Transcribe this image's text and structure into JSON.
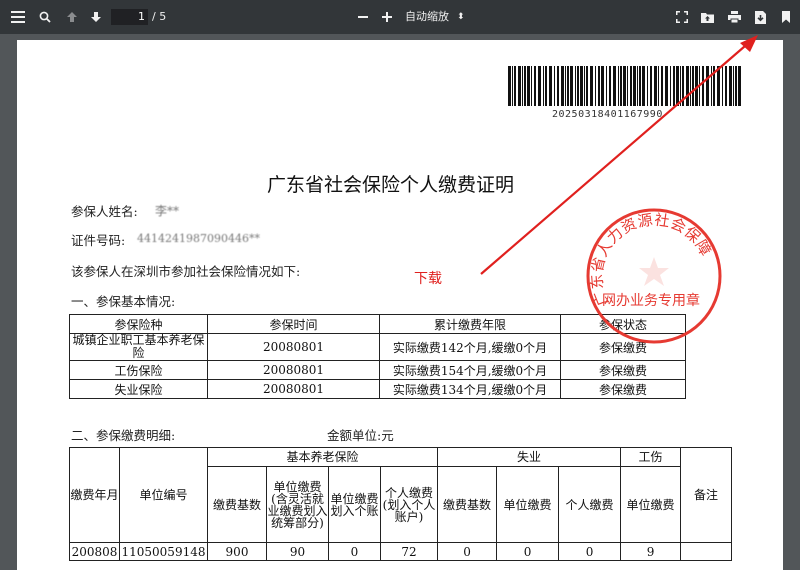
{
  "toolbar": {
    "page_current": "1",
    "page_total": "/ 5",
    "zoom_label": "自动缩放"
  },
  "document": {
    "barcode_number": "20250318401167990",
    "title": "广东省社会保险个人缴费证明",
    "name_label": "参保人姓名:",
    "name_value": "李**",
    "id_label": "证件号码:",
    "id_value": "4414241987090446**",
    "intro": "该参保人在深圳市参加社会保险情况如下:",
    "section1": "一、参保基本情况:",
    "basic_table": {
      "headers": [
        "参保险种",
        "参保时间",
        "累计缴费年限",
        "参保状态"
      ],
      "rows": [
        [
          "城镇企业职工基本养老保险",
          "20080801",
          "实际缴费142个月,缓缴0个月",
          "参保缴费"
        ],
        [
          "工伤保险",
          "20080801",
          "实际缴费154个月,缓缴0个月",
          "参保缴费"
        ],
        [
          "失业保险",
          "20080801",
          "实际缴费134个月,缓缴0个月",
          "参保缴费"
        ]
      ]
    },
    "section2": "二、参保缴费明细:",
    "unit_label": "金额单位:元",
    "detail_table": {
      "col_month": "缴费年月",
      "col_unit_no": "单位编号",
      "group_pension": "基本养老保险",
      "group_unemployment": "失业",
      "group_injury": "工伤",
      "col_remark": "备注",
      "sub_headers": [
        "缴费基数",
        "单位缴费(含灵活就业缴费划入统筹部分)",
        "单位缴费划入个账",
        "个人缴费(划入个人账户)",
        "缴费基数",
        "单位缴费",
        "个人缴费",
        "单位缴费"
      ],
      "first_row": [
        "200808",
        "11050059148",
        "900",
        "90",
        "0",
        "72",
        "0",
        "0",
        "0",
        "9",
        ""
      ]
    },
    "annotation_label": "下载",
    "seal_text_main": "广东省人力资源社会保障",
    "seal_text_bottom": "网办业务专用章"
  },
  "colors": {
    "toolbar_bg": "#323639",
    "viewer_bg": "#525659",
    "annotation_red": "#e0201e",
    "seal_red": "#e63a32"
  }
}
